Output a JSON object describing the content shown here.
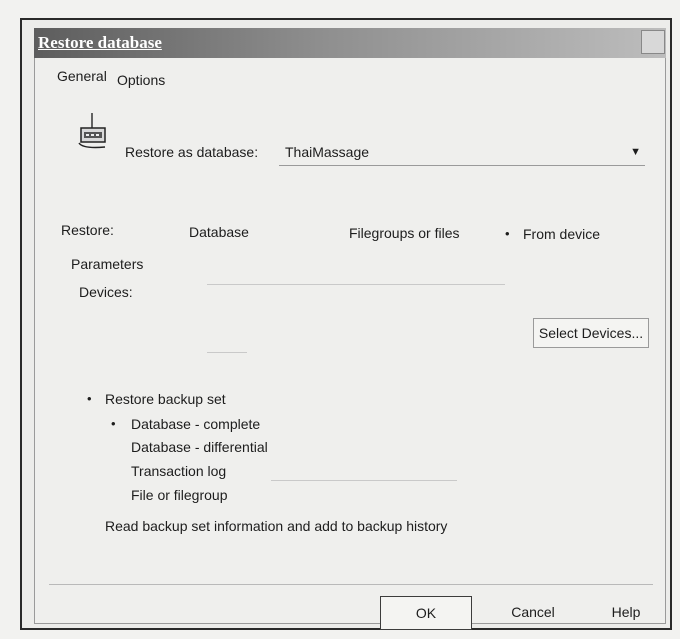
{
  "window": {
    "title": "Restore database"
  },
  "tabs": [
    {
      "label": "General"
    },
    {
      "label": "Options"
    }
  ],
  "restore_as": {
    "label": "Restore as database:",
    "value": "ThaiMassage"
  },
  "restore": {
    "label": "Restore:",
    "options": [
      "Database",
      "Filegroups or files",
      "From device"
    ],
    "selected": "From device"
  },
  "parameters": {
    "label": "Parameters",
    "devices_label": "Devices:",
    "select_devices_button": "Select Devices..."
  },
  "backup": {
    "restore_backup_set": "Restore backup set",
    "options": [
      "Database - complete",
      "Database - differential",
      "Transaction log",
      "File or filegroup"
    ],
    "selected": "Database - complete",
    "read_info": "Read backup set information and add to backup history"
  },
  "buttons": {
    "ok": "OK",
    "cancel": "Cancel",
    "help": "Help"
  }
}
